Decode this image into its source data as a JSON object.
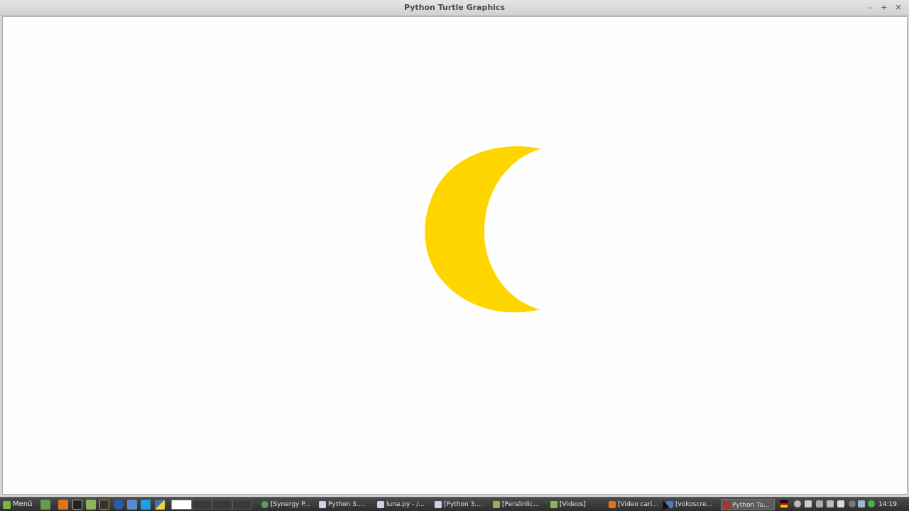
{
  "window": {
    "title": "Python Turtle Graphics",
    "controls": {
      "minimize": "–",
      "maximize": "+",
      "close": "✕"
    }
  },
  "canvas": {
    "background": "#fefefe",
    "shape": {
      "name": "crescent-moon",
      "color": "#ffd500"
    }
  },
  "taskbar": {
    "menu_label": "Menü",
    "quicklaunch_icons": [
      "show-desktop-icon",
      "firefox-icon",
      "terminal-icon",
      "files-icon",
      "terminal-app-icon",
      "browser-icon",
      "display-icon",
      "skype-icon",
      "python-icon"
    ],
    "workspaces": 4,
    "active_workspace": 1,
    "tasks": [
      {
        "label": "[Synergy P...",
        "icon": "synergy-icon",
        "active": false
      },
      {
        "label": "Python 3....",
        "icon": "editor-icon",
        "active": false
      },
      {
        "label": "luna.py - /...",
        "icon": "editor-icon",
        "active": false
      },
      {
        "label": "[Python 3....",
        "icon": "editor-icon",
        "active": false
      },
      {
        "label": "[Persönlic...",
        "icon": "folder-icon",
        "active": false
      },
      {
        "label": "[Videos]",
        "icon": "folder-icon",
        "active": false
      },
      {
        "label": "[Video cari...",
        "icon": "firefox-icon",
        "active": false
      },
      {
        "label": "[vokoscre...",
        "icon": "vokoscreen-icon",
        "active": false
      },
      {
        "label": "Python Tu...",
        "icon": "turtle-icon",
        "active": true
      }
    ],
    "tray_icons": [
      "german-flag-icon",
      "user-icon",
      "clipboard-icon",
      "network-icon",
      "volume-icon",
      "battery-icon",
      "record-icon",
      "shield-icon",
      "update-icon"
    ],
    "clock": "14:19"
  },
  "colors": {
    "moon": "#ffd500",
    "taskbar": "#3a3a3a",
    "titlebar": "#dcdcdc"
  }
}
